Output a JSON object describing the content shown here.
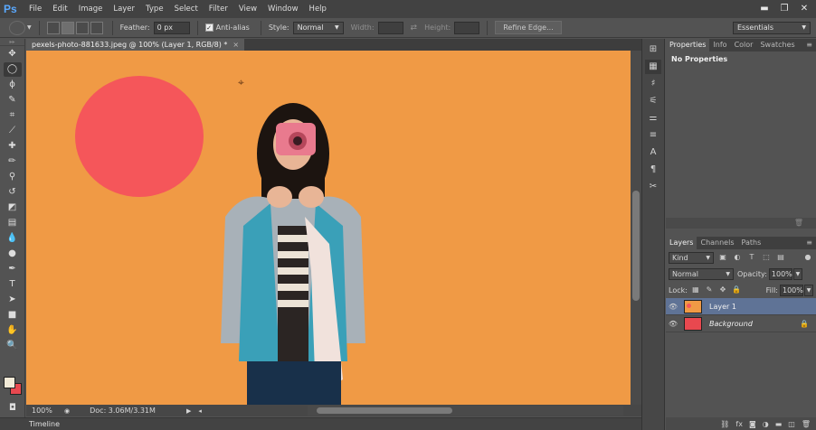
{
  "app": {
    "logo": "Ps",
    "menu": [
      "File",
      "Edit",
      "Image",
      "Layer",
      "Type",
      "Select",
      "Filter",
      "View",
      "Window",
      "Help"
    ],
    "window_controls": {
      "minimize": "▬",
      "restore": "❐",
      "close": "✕"
    }
  },
  "options": {
    "feather_label": "Feather:",
    "feather_value": "0 px",
    "antialias_label": "Anti-alias",
    "antialias_checked": true,
    "style_label": "Style:",
    "style_value": "Normal",
    "width_label": "Width:",
    "height_label": "Height:",
    "refine_edge": "Refine Edge...",
    "workspace": "Essentials"
  },
  "document": {
    "tab_title": "pexels-photo-881633.jpeg @ 100% (Layer 1, RGB/8) *",
    "zoom": "100%",
    "doc_size": "Doc: 3.06M/3.31M"
  },
  "colors": {
    "foreground": "#f2ead7",
    "background": "#e8484f",
    "canvas_bg": "#f09a45",
    "circle": "#f5565a",
    "selection": "#5f7396"
  },
  "timeline": {
    "label": "Timeline"
  },
  "properties": {
    "tabs": [
      "Properties",
      "Info",
      "Color",
      "Swatches"
    ],
    "title": "No Properties"
  },
  "layers": {
    "tabs": [
      "Layers",
      "Channels",
      "Paths"
    ],
    "kind_label": "Kind",
    "blend_mode": "Normal",
    "opacity_label": "Opacity:",
    "opacity_value": "100%",
    "lock_label": "Lock:",
    "fill_label": "Fill:",
    "fill_value": "100%",
    "items": [
      {
        "name": "Layer 1",
        "selected": true
      },
      {
        "name": "Background",
        "selected": false
      }
    ]
  }
}
